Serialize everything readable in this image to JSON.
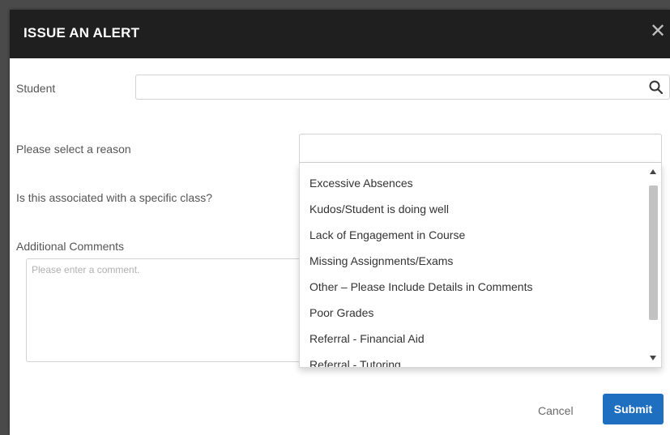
{
  "dialog": {
    "title": "ISSUE AN ALERT",
    "close_symbol": "✕"
  },
  "form": {
    "student_label": "Student",
    "student_value": "",
    "reason_label": "Please select a reason",
    "class_label": "Is this associated with a specific class?",
    "comments_label": "Additional Comments",
    "comments_placeholder": "Please enter a comment."
  },
  "reason_options": [
    "Excessive Absences",
    "Kudos/Student is doing well",
    "Lack of Engagement in Course",
    "Missing Assignments/Exams",
    "Other – Please Include Details in Comments",
    "Poor Grades",
    "Referral - Financial Aid",
    "Referral - Tutoring"
  ],
  "footer": {
    "cancel_label": "Cancel",
    "submit_label": "Submit"
  },
  "icons": {
    "search": "search-icon",
    "close": "close-icon",
    "scroll_up": "caret-up-icon",
    "scroll_down": "caret-down-icon"
  },
  "colors": {
    "header_bg": "#1f1f1f",
    "submit_bg": "#1f6fc1"
  }
}
